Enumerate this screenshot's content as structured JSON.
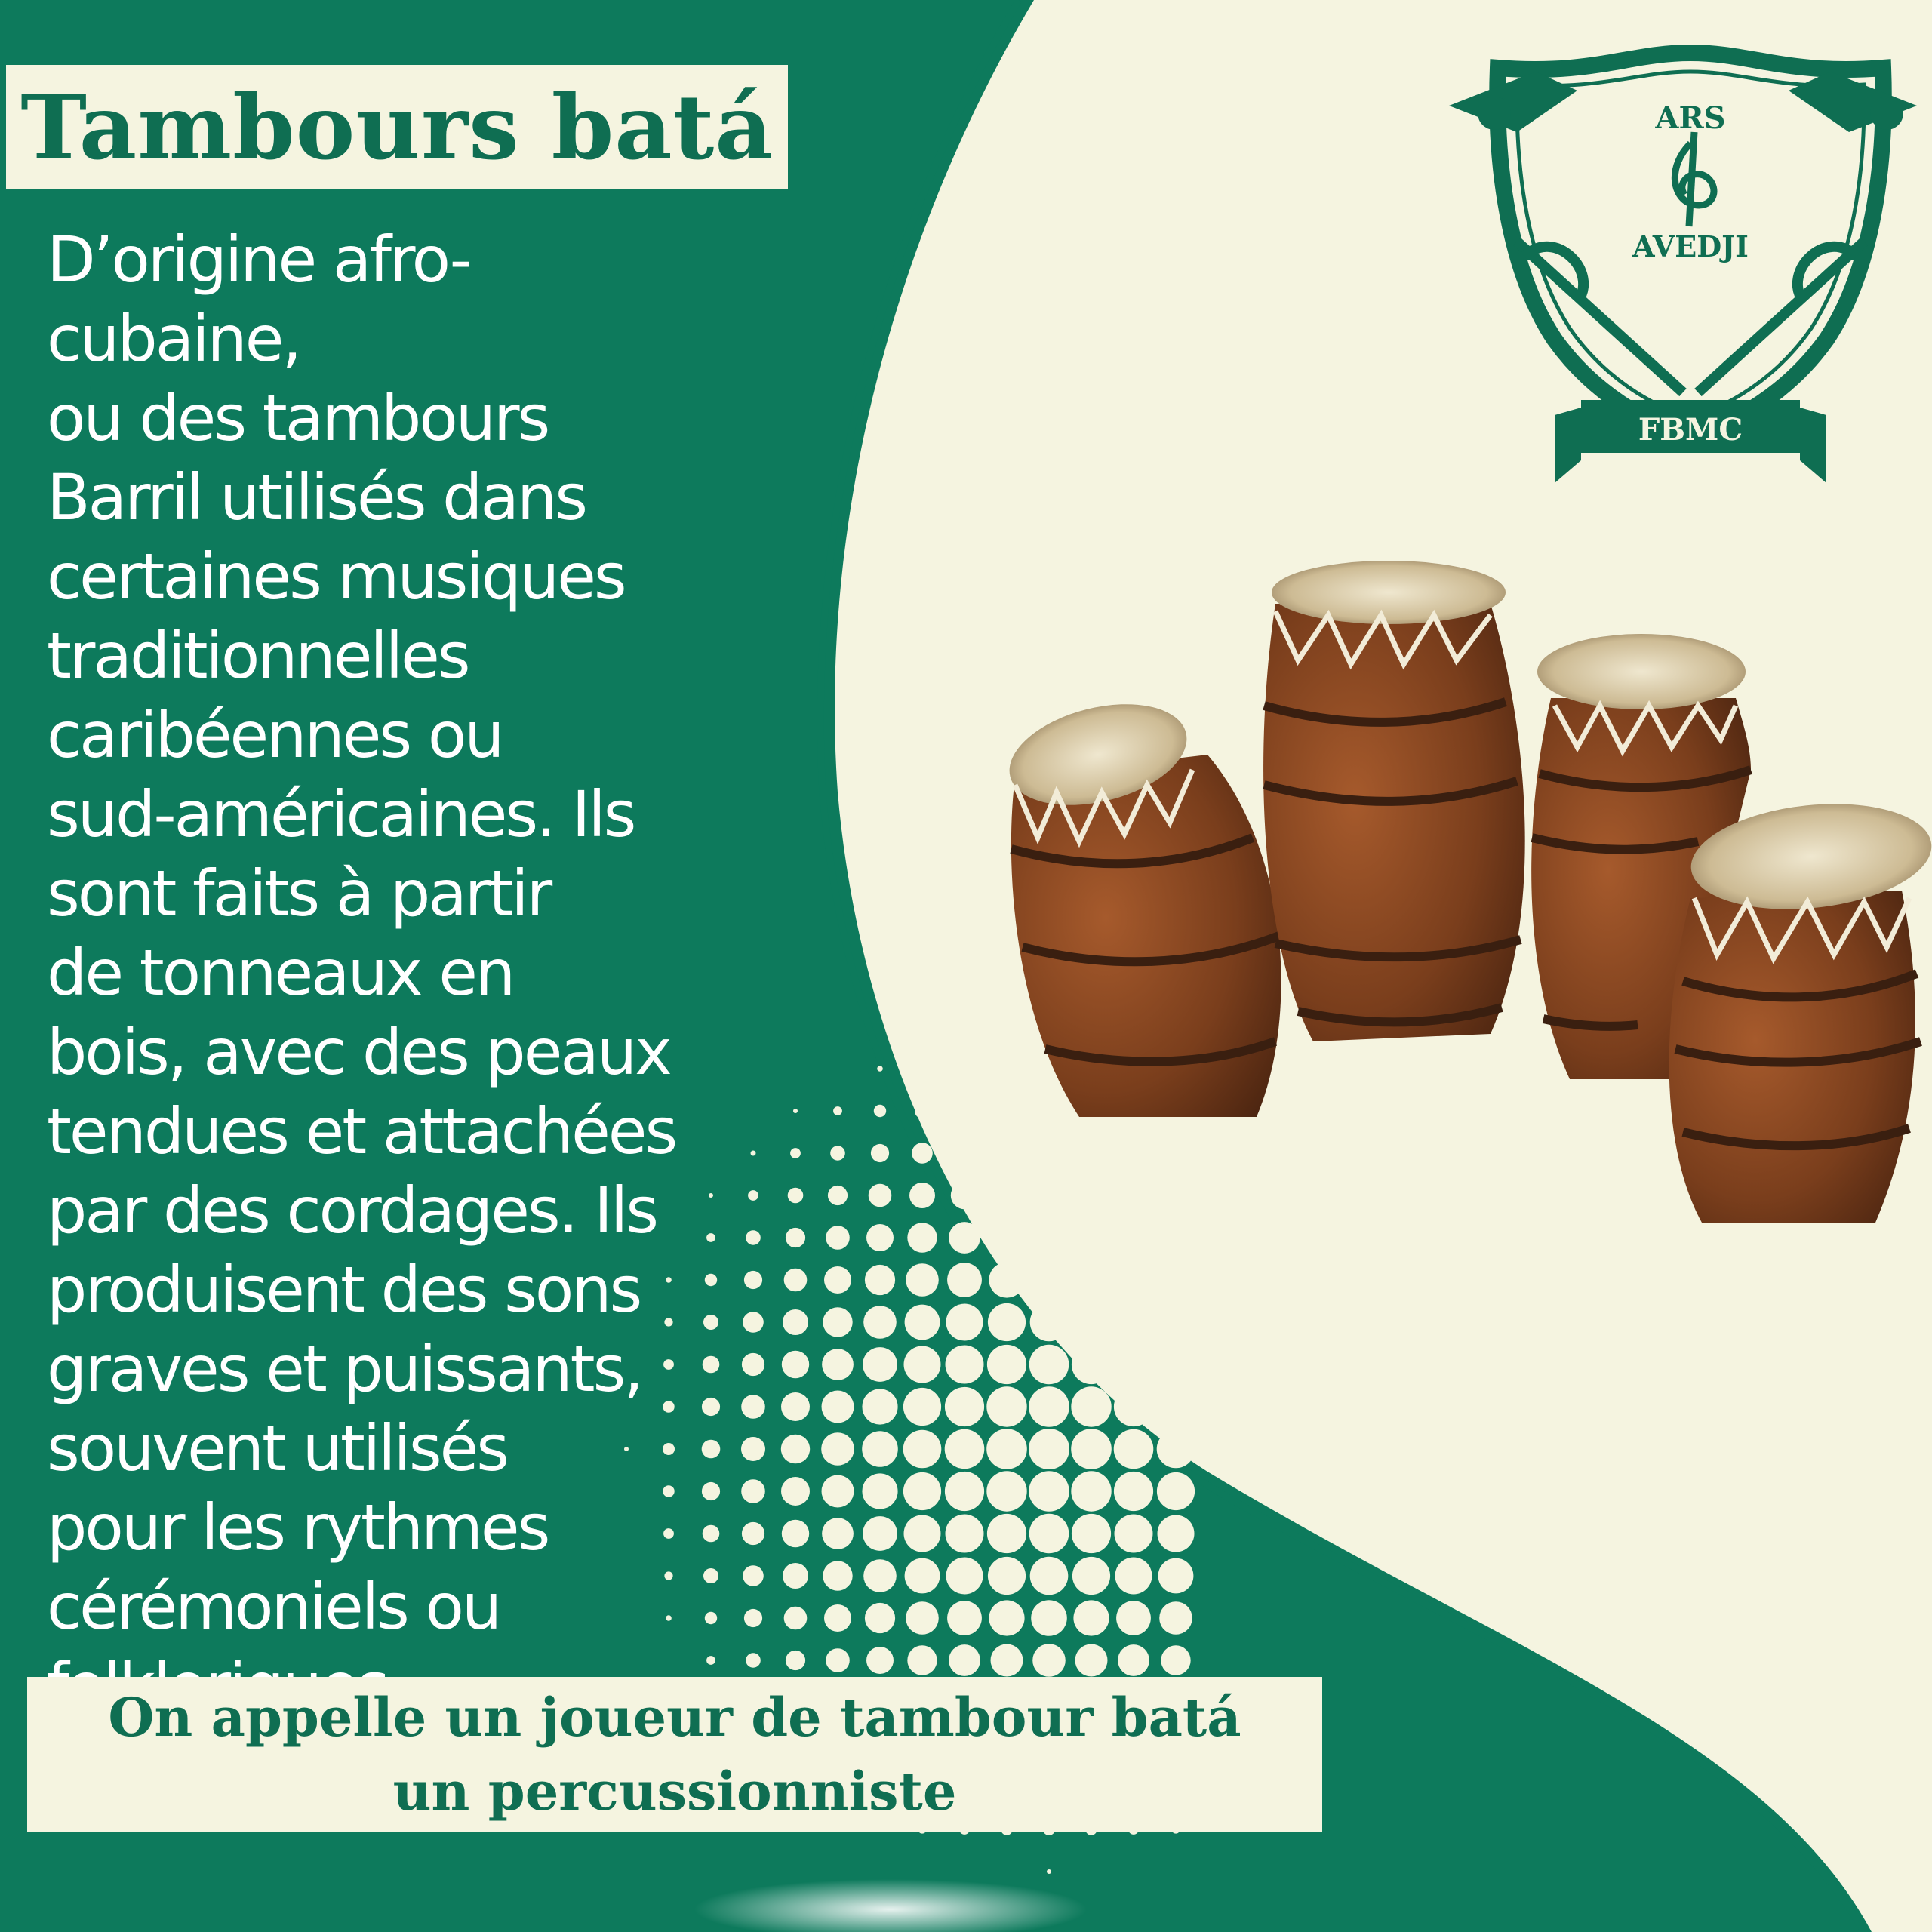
{
  "title": "Tambours batá",
  "description": "D’origine afro-cubaine,\nou des tambours\nBarril utilisés dans\ncertaines musiques\ntraditionnelles\ncaribéennes ou\nsud-américaines. Ils\nsont faits à partir\nde tonneaux en\nbois, avec des peaux\ntendues et attachées\npar des cordages. Ils\nproduisent des sons\ngraves et puissants,\nsouvent utilisés\npour les rythmes\ncérémoniels ou\nfolkloriques",
  "footer": {
    "line1": "On appelle un joueur de tambour batá",
    "line2": "un percussionniste"
  },
  "emblem": {
    "top_text": "ARS",
    "middle_text": "AVEDJI",
    "ribbon_text": "FBMC"
  },
  "colors": {
    "green": "#0d7a5c",
    "cream": "#f5f4e0",
    "text_green": "#0f6e52",
    "wood": "#7a3e1c"
  }
}
